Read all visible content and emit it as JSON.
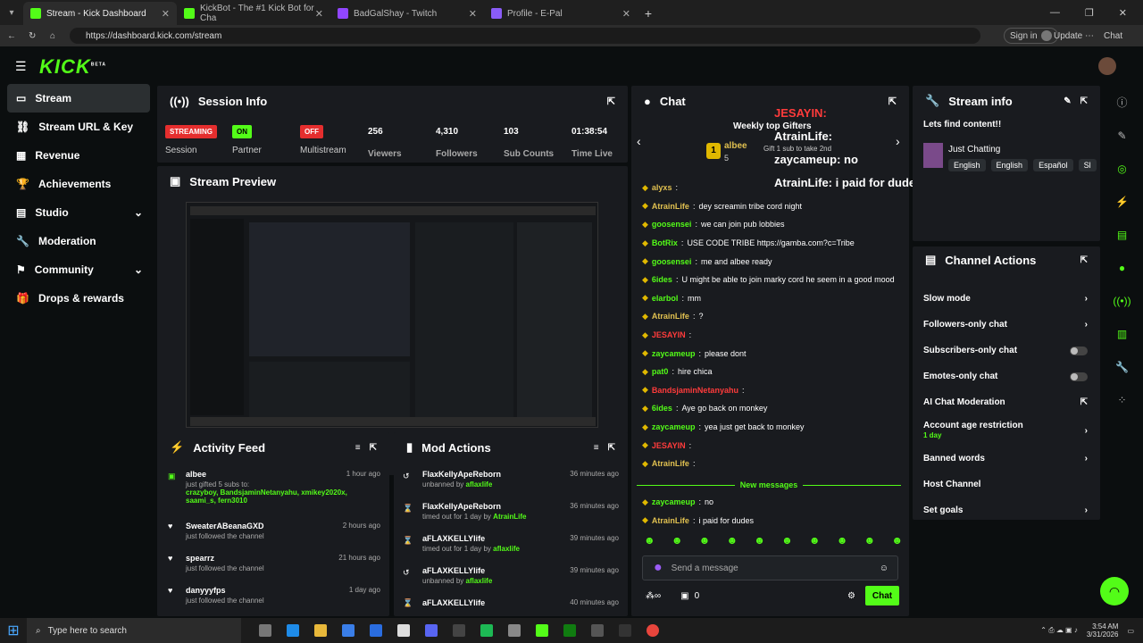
{
  "browser": {
    "tabs": [
      "Stream - Kick Dashboard",
      "KickBot - The #1 Kick Bot for Cha",
      "BadGalShay - Twitch",
      "Profile - E-Pal"
    ],
    "url": "https://dashboard.kick.com/stream",
    "signin": "Sign in",
    "update": "Update",
    "chat": "Chat"
  },
  "brand": {
    "logo": "KICK",
    "beta": "BETA"
  },
  "sidebar": [
    "Stream",
    "Stream URL & Key",
    "Revenue",
    "Achievements",
    "Studio",
    "Moderation",
    "Community",
    "Drops & rewards"
  ],
  "session": {
    "title": "Session Info",
    "stats": [
      {
        "badge": "STREAMING",
        "label": "Session",
        "color": "#e52e2e"
      },
      {
        "badge": "ON",
        "label": "Partner",
        "color": "#53fc18"
      },
      {
        "badge": "OFF",
        "label": "Multistream",
        "color": "#e52e2e"
      },
      {
        "value": "256",
        "label": "Viewers"
      },
      {
        "value": "4,310",
        "label": "Followers"
      },
      {
        "value": "103",
        "label": "Sub Counts"
      },
      {
        "value": "01:38:54",
        "label": "Time Live"
      }
    ]
  },
  "preview": {
    "title": "Stream Preview"
  },
  "activity": {
    "title": "Activity Feed",
    "items": [
      {
        "name": "albee",
        "time": "1 hour ago",
        "line1": "just gifted 5 subs to:",
        "line2": "crazyboy, BandsjaminNetanyahu, xmikey2020x,",
        "line3": "saami_s, fern3010"
      },
      {
        "name": "SweaterABeanaGXD",
        "time": "2 hours ago",
        "line1": "just followed the channel"
      },
      {
        "name": "spearrz",
        "time": "21 hours ago",
        "line1": "just followed the channel"
      },
      {
        "name": "danyyyfps",
        "time": "1 day ago",
        "line1": "just followed the channel"
      }
    ]
  },
  "mod": {
    "title": "Mod Actions",
    "items": [
      {
        "name": "FlaxKellyApeReborn",
        "time": "36 minutes ago",
        "action": "unbanned by",
        "by": "aflaxlife"
      },
      {
        "name": "FlaxKellyApeReborn",
        "time": "36 minutes ago",
        "action": "timed out for 1 day by",
        "by": "AtrainLife"
      },
      {
        "name": "aFLAXKELLYlife",
        "time": "39 minutes ago",
        "action": "timed out for 1 day by",
        "by": "aflaxlife"
      },
      {
        "name": "aFLAXKELLYlife",
        "time": "39 minutes ago",
        "action": "unbanned by",
        "by": "aflaxlife"
      },
      {
        "name": "aFLAXKELLYlife",
        "time": "40 minutes ago",
        "action": "",
        "by": ""
      }
    ]
  },
  "chat": {
    "title": "Chat",
    "gifter_title": "Weekly top Gifters",
    "gifter_name": "albee",
    "gifter_count": "5",
    "gift_note": "Gift 1 sub to take 2nd",
    "overlay": [
      "JESAYIN:",
      "AtrainLife:",
      "zaycameup: no",
      "AtrainLife: i paid for dudes"
    ],
    "messages": [
      {
        "name": "alyxs",
        "text": "",
        "color": "#e0c050"
      },
      {
        "name": "AtrainLife",
        "text": "dey screamin tribe cord night",
        "color": "#e0c050"
      },
      {
        "name": "goosensei",
        "text": "we can join pub lobbies",
        "color": "#53fc18"
      },
      {
        "name": "BotRix",
        "text": "USE CODE TRIBE https://gamba.com?c=Tribe",
        "color": "#53fc18"
      },
      {
        "name": "goosensei",
        "text": "me and albee ready",
        "color": "#53fc18"
      },
      {
        "name": "6ides",
        "text": "U might be able to join marky cord he seem in a good mood",
        "color": "#53fc18"
      },
      {
        "name": "elarbol",
        "text": "mm",
        "color": "#53fc18"
      },
      {
        "name": "AtrainLife",
        "text": "?",
        "color": "#e0c050"
      },
      {
        "name": "JESAYIN",
        "text": "",
        "color": "#ff3b3b"
      },
      {
        "name": "zaycameup",
        "text": "please dont",
        "color": "#53fc18"
      },
      {
        "name": "pat0",
        "text": "hire chica",
        "color": "#53fc18"
      },
      {
        "name": "BandsjaminNetanyahu",
        "text": "",
        "color": "#ff3b3b"
      },
      {
        "name": "6ides",
        "text": "Aye go back on monkey",
        "color": "#53fc18"
      },
      {
        "name": "zaycameup",
        "text": "yea just get back to monkey",
        "color": "#53fc18"
      },
      {
        "name": "JESAYIN",
        "text": "",
        "color": "#ff3b3b"
      },
      {
        "name": "AtrainLife",
        "text": "",
        "color": "#e0c050"
      }
    ],
    "new_messages": "New messages",
    "after": [
      {
        "name": "zaycameup",
        "text": "no",
        "color": "#53fc18"
      },
      {
        "name": "AtrainLife",
        "text": "i paid for dudes",
        "color": "#e0c050"
      }
    ],
    "placeholder": "Send a message",
    "points": "0",
    "send": "Chat"
  },
  "stream_info": {
    "title": "Stream info",
    "stream_title": "Lets find content!!",
    "category": "Just Chatting",
    "tags": [
      "English",
      "English",
      "Español",
      "Sl"
    ]
  },
  "channel_actions": {
    "title": "Channel Actions",
    "items": [
      "Slow mode",
      "Followers-only chat",
      "Subscribers-only chat",
      "Emotes-only chat",
      "AI Chat Moderation",
      "Account age restriction",
      "Banned words",
      "Host Channel",
      "Set goals"
    ],
    "age_note": "1 day"
  },
  "taskbar": {
    "search": "Type here to search",
    "time": "3:54 AM",
    "date": "3/31/2026"
  }
}
